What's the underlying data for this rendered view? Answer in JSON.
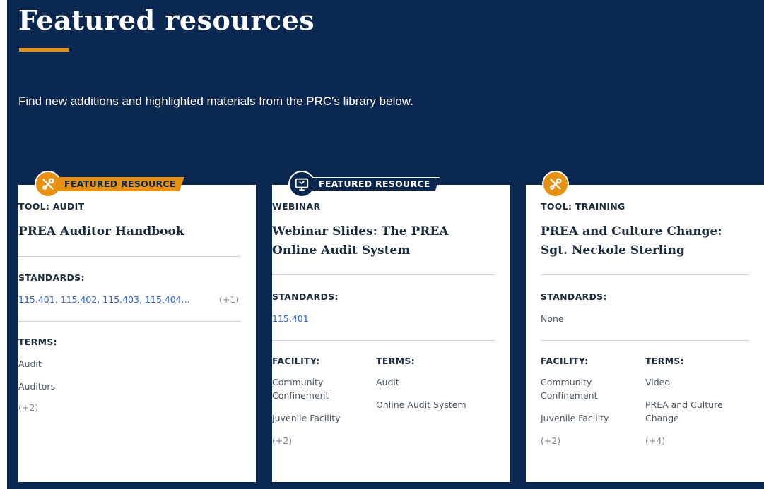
{
  "section": {
    "title": "Featured resources",
    "intro": "Find new additions and highlighted materials from the PRC's library below.",
    "accent_color": "#e8900f",
    "background_color": "#0a2850"
  },
  "cards": [
    {
      "badge": {
        "icon": "tools-icon",
        "label": "FEATURED RESOURCE"
      },
      "type": "TOOL: AUDIT",
      "title": "PREA Auditor Handbook",
      "standards_label": "STANDARDS:",
      "standards": "115.401, 115.402, 115.403, 115.404...",
      "standards_more": "(+1)",
      "terms_label": "TERMS:",
      "terms": [
        "Audit",
        "Auditors"
      ],
      "terms_more": "(+2)"
    },
    {
      "badge": {
        "icon": "webinar-icon",
        "label": "FEATURED RESOURCE"
      },
      "type": "WEBINAR",
      "title": "Webinar Slides: The PREA Online Audit System",
      "standards_label": "STANDARDS:",
      "standards": "115.401",
      "facility_label": "FACILITY:",
      "facility": [
        "Community Confinement",
        "Juvenile Facility"
      ],
      "facility_more": "(+2)",
      "terms_label": "TERMS:",
      "terms": [
        "Audit",
        "Online Audit System"
      ]
    },
    {
      "badge": {
        "icon": "tools-icon"
      },
      "type": "TOOL: TRAINING",
      "title": "PREA and Culture Change: Sgt. Neckole Sterling",
      "standards_label": "STANDARDS:",
      "standards": "None",
      "facility_label": "FACILITY:",
      "facility": [
        "Community Confinement",
        "Juvenile Facility"
      ],
      "facility_more": "(+2)",
      "terms_label": "TERMS:",
      "terms": [
        "Video",
        "PREA and Culture Change"
      ],
      "terms_more": "(+4)"
    }
  ]
}
